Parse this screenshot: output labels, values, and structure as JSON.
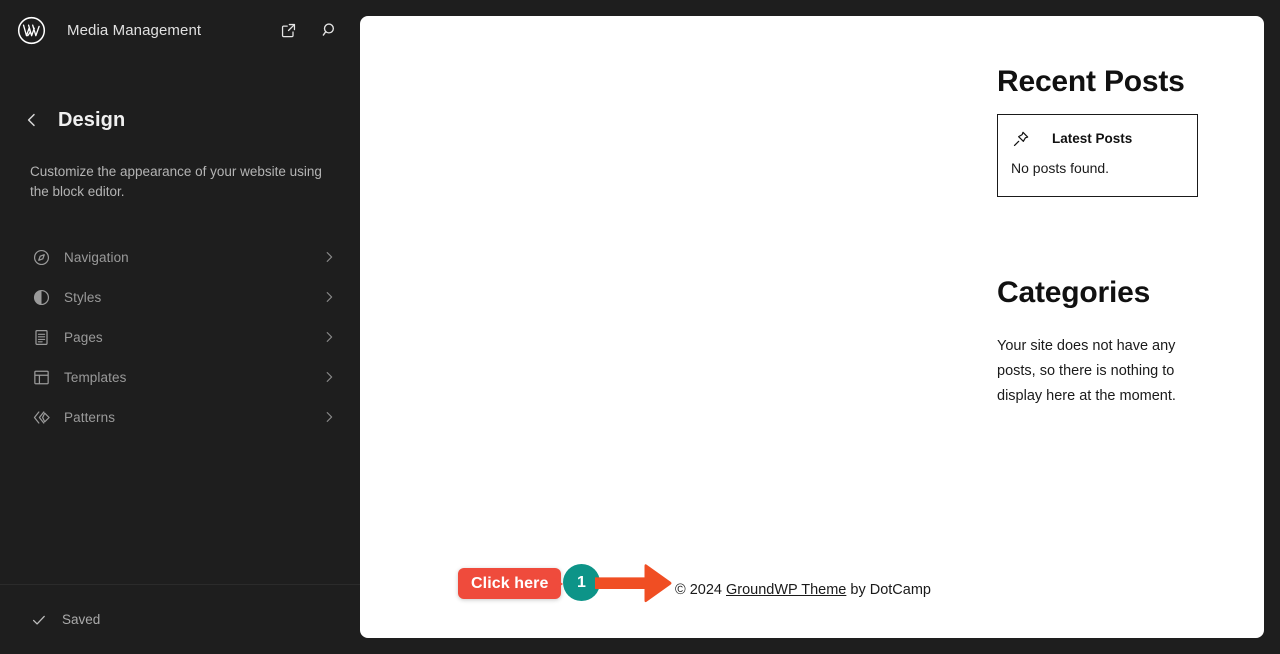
{
  "sidebar": {
    "logo_icon": "wordpress-logo-icon",
    "site_title": "Media Management",
    "header_actions": [
      {
        "name": "view-site-button",
        "icon": "external-link-icon"
      },
      {
        "name": "search-button",
        "icon": "search-icon"
      }
    ],
    "back_icon": "chevron-left-icon",
    "section_title": "Design",
    "section_description": "Customize the appearance of your website using the block editor.",
    "menu": [
      {
        "label": "Navigation",
        "icon": "navigation-compass-icon",
        "chevron": "chevron-right-icon"
      },
      {
        "label": "Styles",
        "icon": "styles-contrast-icon",
        "chevron": "chevron-right-icon"
      },
      {
        "label": "Pages",
        "icon": "pages-document-icon",
        "chevron": "chevron-right-icon"
      },
      {
        "label": "Templates",
        "icon": "templates-layout-icon",
        "chevron": "chevron-right-icon"
      },
      {
        "label": "Patterns",
        "icon": "patterns-chevrons-icon",
        "chevron": "chevron-right-icon"
      }
    ],
    "footer": {
      "status_icon": "check-icon",
      "status_label": "Saved"
    }
  },
  "canvas": {
    "recent_posts": {
      "heading": "Recent Posts",
      "block": {
        "icon": "pin-icon",
        "title": "Latest Posts",
        "body": "No posts found."
      }
    },
    "categories": {
      "heading": "Categories",
      "body": "Your site does not have any posts, so there is nothing to display here at the moment."
    },
    "footer": {
      "prefix": "© 2024 ",
      "link_text": "GroundWP Theme",
      "suffix": " by DotCamp"
    }
  },
  "annotation": {
    "badge_label": "Click here",
    "step_number": "1",
    "arrow_icon": "arrow-right-icon",
    "colors": {
      "badge": "#ef4b3c",
      "circle": "#0d9488",
      "arrow": "#f04e23"
    }
  },
  "theme": {
    "sidebar_bg": "#1e1e1e",
    "canvas_bg": "#ffffff",
    "text_muted": "#9a9a9a"
  }
}
